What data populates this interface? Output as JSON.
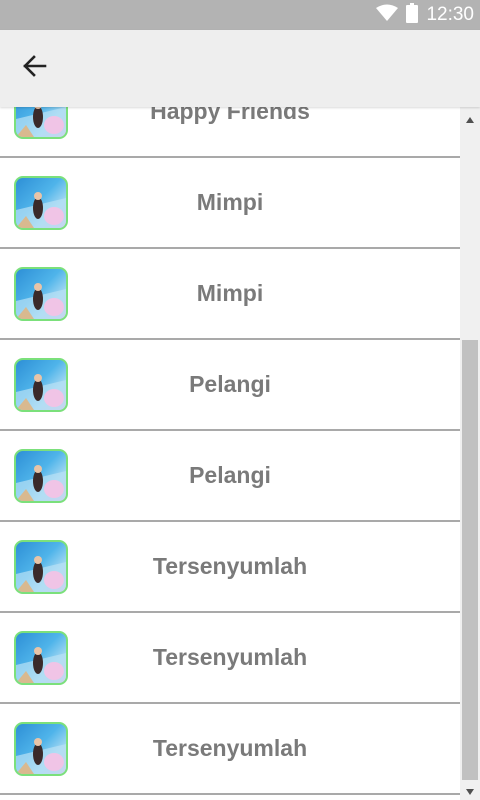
{
  "status_bar": {
    "time": "12:30",
    "icons": [
      "wifi-icon",
      "battery-icon"
    ]
  },
  "toolbar": {
    "back_icon": "arrow-left-icon"
  },
  "list": {
    "items": [
      {
        "title": "Happy Friends"
      },
      {
        "title": "Mimpi"
      },
      {
        "title": "Mimpi"
      },
      {
        "title": "Pelangi"
      },
      {
        "title": "Pelangi"
      },
      {
        "title": "Tersenyumlah"
      },
      {
        "title": "Tersenyumlah"
      },
      {
        "title": "Tersenyumlah"
      }
    ]
  },
  "colors": {
    "status_bar_bg": "#b3b3b3",
    "toolbar_bg": "#eeeeee",
    "item_text": "#7a7a7a",
    "divider": "#a9a9a9",
    "thumb_border": "#7be07b"
  }
}
